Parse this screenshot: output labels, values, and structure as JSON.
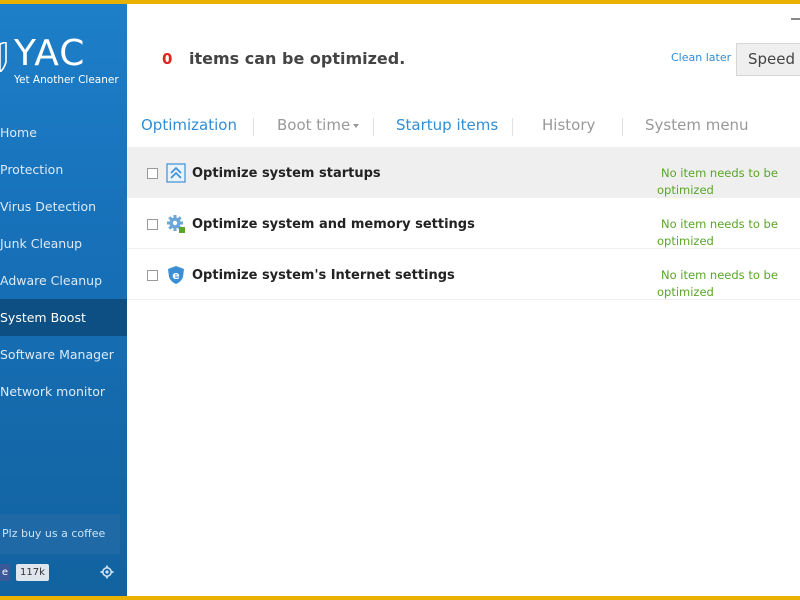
{
  "app": {
    "logo_text": "YAC",
    "tagline": "Yet Another Cleaner"
  },
  "sidebar": {
    "items": [
      {
        "label": "Home"
      },
      {
        "label": "Protection"
      },
      {
        "label": "Virus Detection"
      },
      {
        "label": "Junk Cleanup"
      },
      {
        "label": "Adware Cleanup"
      },
      {
        "label": "System Boost"
      },
      {
        "label": "Software Manager"
      },
      {
        "label": "Network monitor"
      }
    ],
    "active": "System Boost",
    "coffee_label": "Plz buy us a coffee",
    "like_label": "e",
    "like_count": "117k"
  },
  "header": {
    "count": "0",
    "count_text": "items can be optimized.",
    "clean_later": "Clean later",
    "speed_button": "Speed up"
  },
  "tabs": [
    {
      "label": "Optimization"
    },
    {
      "label": "Boot time"
    },
    {
      "label": "Startup items"
    },
    {
      "label": "History"
    },
    {
      "label": "System menu"
    }
  ],
  "rows": [
    {
      "title": "Optimize system startups",
      "status": "No item needs to be optimized",
      "icon": "startup-arrows-icon"
    },
    {
      "title": "Optimize system and memory settings",
      "status": "No item needs to be optimized",
      "icon": "gear-icon"
    },
    {
      "title": "Optimize system's Internet settings",
      "status": "No item needs to be optimized",
      "icon": "internet-shield-icon"
    }
  ],
  "colors": {
    "sidebar": "#1770b8",
    "sidebar_active": "#0d4f82",
    "accent_blue": "#2f8ed6",
    "count_red": "#e0251f",
    "status_green": "#5aa52a",
    "frame_yellow": "#e9b200"
  }
}
